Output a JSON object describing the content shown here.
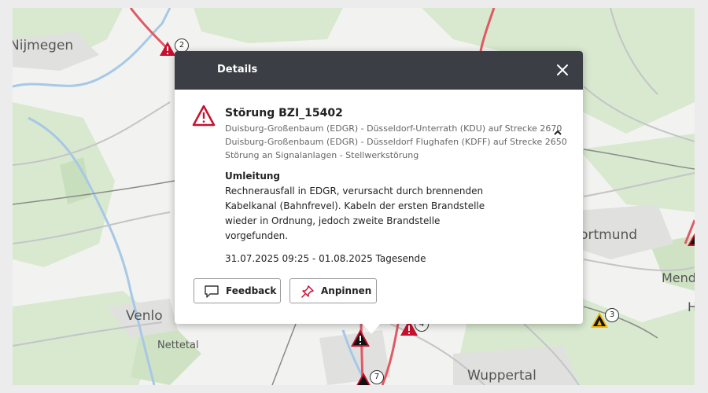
{
  "map": {
    "cities": [
      {
        "name": "Nijmegen"
      },
      {
        "name": "Venlo"
      },
      {
        "name": "Nettetal"
      },
      {
        "name": "Dortmund"
      },
      {
        "name": "Wuppertal"
      },
      {
        "name": "Mende"
      },
      {
        "name": "H"
      }
    ],
    "markers": [
      {
        "count": "2"
      },
      {
        "count": "4"
      },
      {
        "count": "7"
      },
      {
        "count": "3"
      }
    ],
    "colors": {
      "disruption_red": "#c8102e",
      "warning_yellow": "#f2b707",
      "route_pink": "#e05a64"
    }
  },
  "popup": {
    "header_title": "Details",
    "incident_title": "Störung BZI_15402",
    "routes": [
      "Duisburg-Großenbaum (EDGR) - Düsseldorf-Unterrath (KDU) auf Strecke 2670",
      "Duisburg-Großenbaum (EDGR) - Düsseldorf Flughafen (KDFF) auf Strecke 2650",
      "Störung an Signalanlagen - Stellwerkstörung"
    ],
    "section_heading": "Umleitung",
    "description_lines": [
      "Rechnerausfall in EDGR, verursacht durch brennenden",
      "Kabelkanal (Bahnfrevel). Kabeln der ersten Brandstelle",
      "wieder in Ordnung, jedoch zweite Brandstelle",
      "vorgefunden."
    ],
    "period": "31.07.2025 09:25 - 01.08.2025 Tagesende",
    "feedback_label": "Feedback",
    "pin_label": "Anpinnen",
    "icons": [
      "close-icon",
      "warning-icon",
      "chevron-up-icon",
      "speech-bubble-icon",
      "pin-icon"
    ]
  }
}
